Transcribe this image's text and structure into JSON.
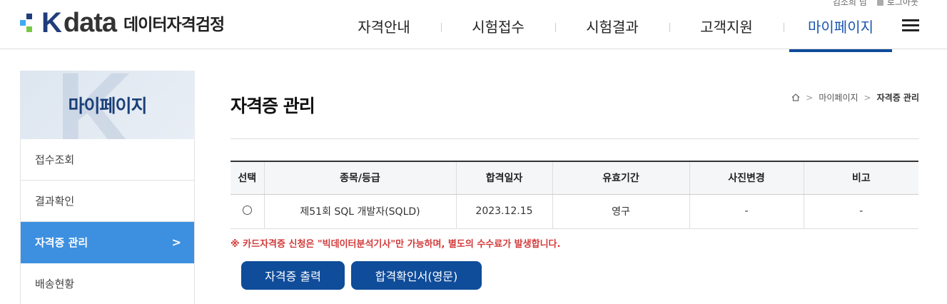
{
  "header": {
    "logo_k": "K",
    "logo_data": "data",
    "logo_sub": "데이터자격검정",
    "user_name": "김소희 님",
    "logout_label": "로그아웃",
    "nav": [
      "자격안내",
      "시험접수",
      "시험결과",
      "고객지원",
      "마이페이지"
    ],
    "active_nav": "마이페이지",
    "colors": {
      "brand": "#0f4c9a",
      "active": "#1a56b0"
    }
  },
  "sidebar": {
    "title": "마이페이지",
    "items": [
      {
        "label": "접수조회"
      },
      {
        "label": "결과확인"
      },
      {
        "label": "자격증 관리",
        "arrow": ">"
      },
      {
        "label": "배송현황"
      }
    ],
    "active_item": "자격증 관리",
    "active_color": "#3d8fe0"
  },
  "main": {
    "title": "자격증 관리",
    "breadcrumb": [
      "마이페이지",
      "자격증 관리"
    ],
    "table": {
      "headers": [
        "선택",
        "종목/등급",
        "합격일자",
        "유효기간",
        "사진변경",
        "비고"
      ],
      "rows": [
        {
          "select": "",
          "item": "제51회 SQL 개발자(SQLD)",
          "pass_date": "2023.12.15",
          "validity": "영구",
          "photo": "-",
          "note": "-"
        }
      ]
    },
    "notice": "※ 카드자격증 신청은 \"빅데이터분석기사\"만 가능하며, 별도의 수수료가 발생합니다.",
    "buttons": {
      "print": "자격증 출력",
      "confirm": "합격확인서(영문)"
    }
  }
}
